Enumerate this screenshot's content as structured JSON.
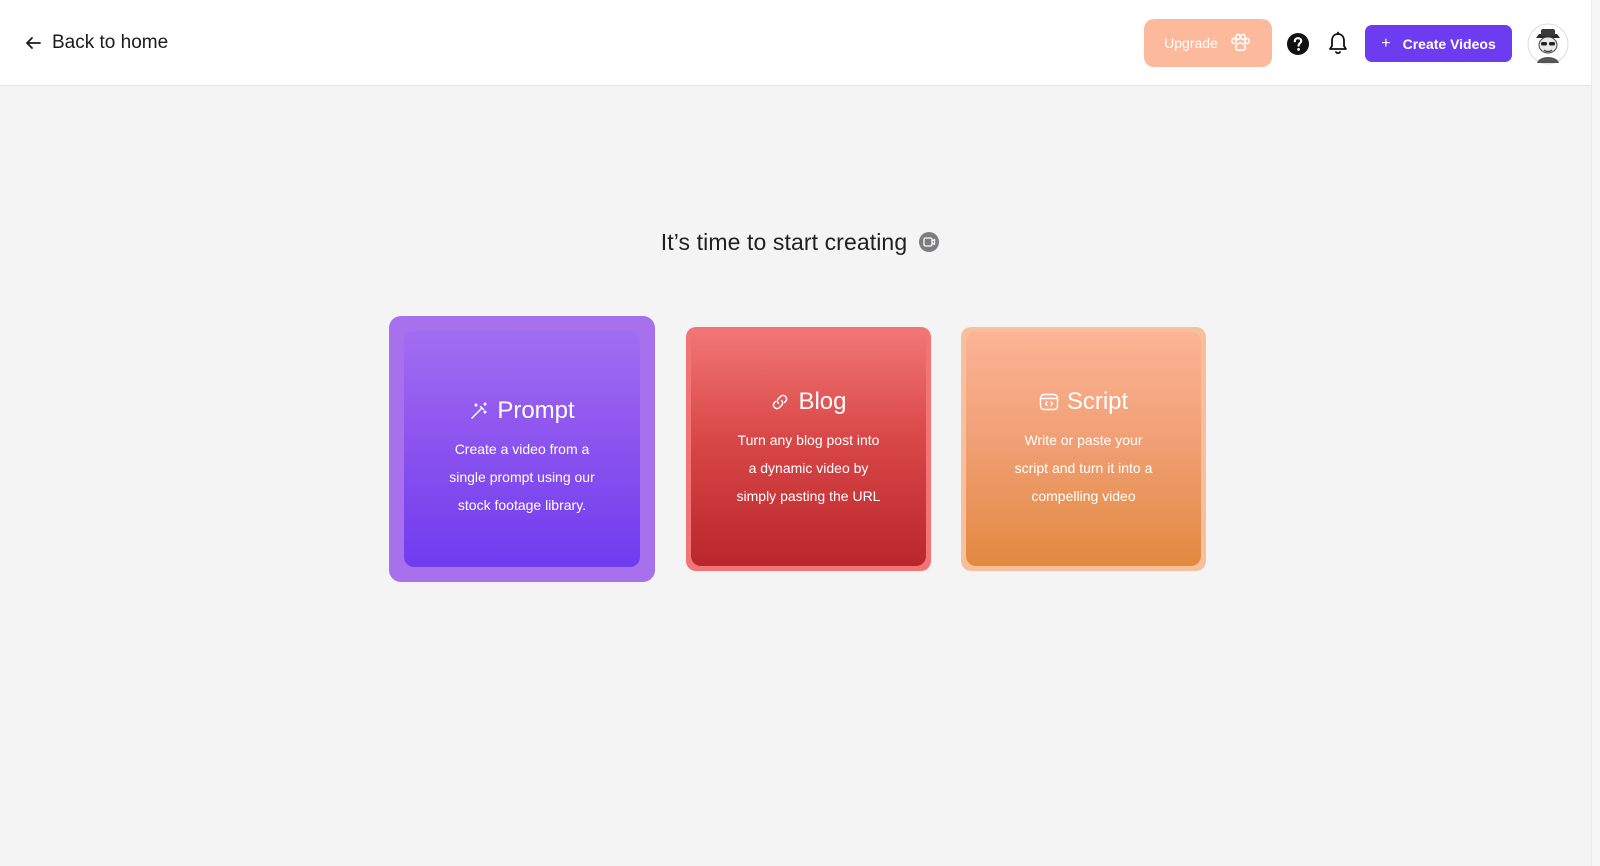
{
  "header": {
    "back_label": "Back to home",
    "upgrade_label": "Upgrade",
    "create_label": "Create Videos",
    "create_prefix": "+"
  },
  "main": {
    "title": "It’s time to start creating"
  },
  "cards": [
    {
      "title": "Prompt",
      "icon": "magic-wand-icon",
      "description": "Create a video from a single prompt using our stock footage library."
    },
    {
      "title": "Blog",
      "icon": "link-icon",
      "description": "Turn any blog post into a dynamic video by simply pasting the URL"
    },
    {
      "title": "Script",
      "icon": "code-window-icon",
      "description": "Write or paste your script and turn it into a compelling video"
    }
  ],
  "colors": {
    "accent": "#6d3cf0",
    "upgrade": "#fdb99b",
    "prompt_card": "#8f57ef",
    "blog_card": "#d94848",
    "script_card": "#f1a076",
    "background": "#f4f4f5"
  },
  "icons": [
    "arrow-left-icon",
    "paw-icon",
    "help-icon",
    "bell-icon",
    "plus-icon",
    "avatar",
    "info-icon"
  ]
}
